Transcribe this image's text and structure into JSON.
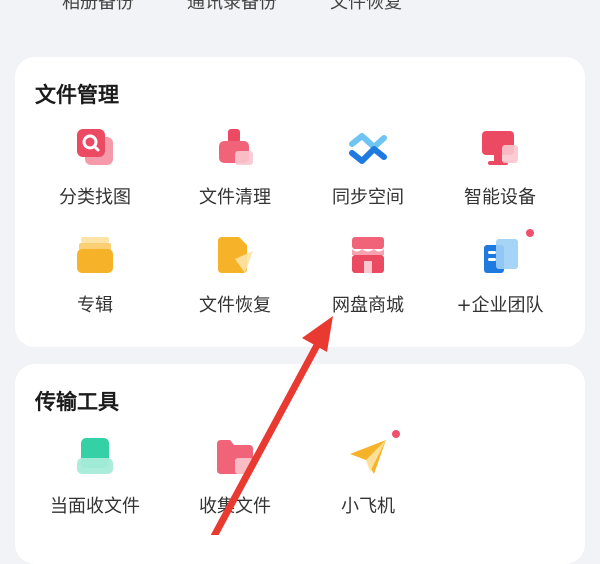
{
  "top_row": {
    "items": [
      "相册备份",
      "通讯录备份",
      "文件恢复"
    ]
  },
  "file_management": {
    "title": "文件管理",
    "items": [
      {
        "label": "分类找图",
        "icon": "magnifier-image-icon"
      },
      {
        "label": "文件清理",
        "icon": "clean-brush-icon"
      },
      {
        "label": "同步空间",
        "icon": "sync-arrows-icon"
      },
      {
        "label": "智能设备",
        "icon": "monitor-device-icon"
      },
      {
        "label": "专辑",
        "icon": "album-box-icon"
      },
      {
        "label": "文件恢复",
        "icon": "file-restore-icon"
      },
      {
        "label": "网盘商城",
        "icon": "store-shop-icon"
      },
      {
        "label": "+企业团队",
        "icon": "enterprise-building-icon",
        "badge": true
      }
    ]
  },
  "transfer_tools": {
    "title": "传输工具",
    "items": [
      {
        "label": "当面收文件",
        "icon": "face-to-face-receive-icon"
      },
      {
        "label": "收集文件",
        "icon": "collect-folder-icon"
      },
      {
        "label": "小飞机",
        "icon": "paper-plane-icon",
        "badge": true
      }
    ]
  },
  "colors": {
    "background": "#f2f3f7",
    "card": "#ffffff",
    "badge": "#f0506e",
    "annotation_arrow": "#e83a30"
  }
}
